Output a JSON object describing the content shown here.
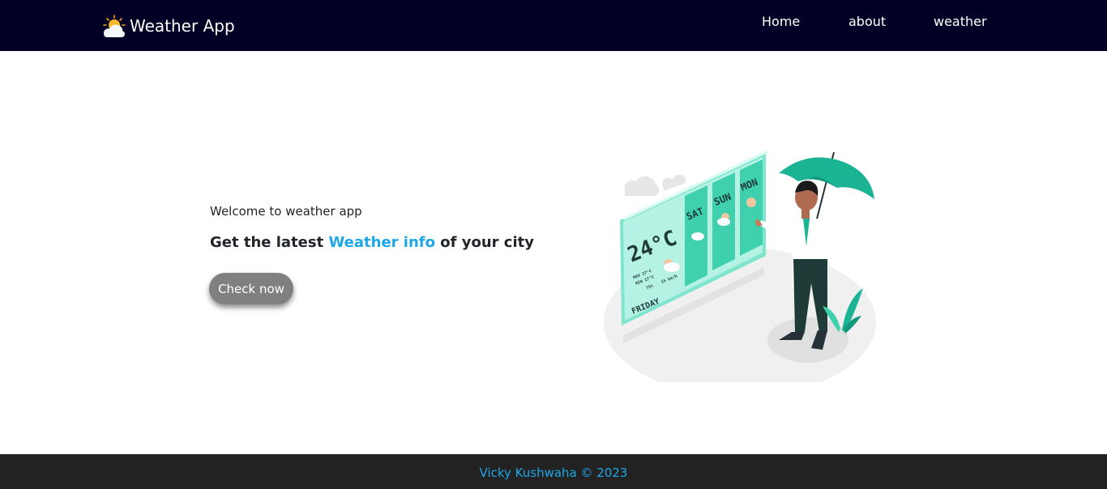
{
  "navbar": {
    "brand_icon": "sun-behind-cloud-icon",
    "brand_name": "Weather App",
    "links": [
      "Home",
      "about",
      "weather"
    ],
    "background": "#020024"
  },
  "hero": {
    "welcome": "Welcome to weather app",
    "headline_before": "Get the latest ",
    "headline_accent": "Weather info",
    "headline_after": " of your city",
    "accent_color": "#1ea7e8",
    "button_label": "Check now"
  },
  "illustration": {
    "temperature": "24°C",
    "day": "FRIDAY",
    "max_label": "MAX",
    "max_value": "27°C",
    "min_label": "MIN",
    "min_value": "17°C",
    "humidity": "75%",
    "wind": "15 km/h",
    "forecast_days": [
      "SAT",
      "SUN",
      "MON"
    ]
  },
  "footer": {
    "text": "Vicky Kushwaha © 2023",
    "background": "#222222"
  }
}
